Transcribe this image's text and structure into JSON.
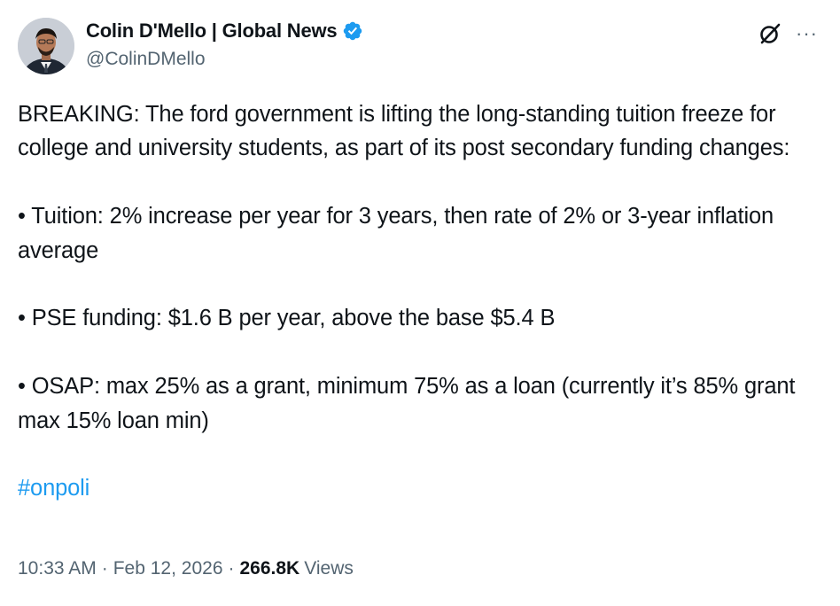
{
  "author": {
    "display_name": "Colin D'Mello | Global News",
    "handle": "@ColinDMello",
    "verified": true,
    "verified_color": "#1d9bf0"
  },
  "header_icons": {
    "grok": "grok-icon",
    "more": "···"
  },
  "tweet": {
    "paragraphs": [
      "BREAKING: The ford government is lifting the long-standing tuition freeze for college and university students, as part of its post secondary funding changes:",
      "• Tuition: 2% increase per year for 3 years, then rate of 2% or 3-year inflation average",
      "• PSE funding: $1.6 B per year, above the base $5.4 B",
      "• OSAP: max 25% as a grant, minimum 75% as a loan (currently it’s 85% grant max 15% loan min)"
    ],
    "hashtag": "#onpoli"
  },
  "meta": {
    "time": "10:33 AM",
    "separator": "·",
    "date": "Feb 12, 2026",
    "views_count": "266.8K",
    "views_label": "Views"
  },
  "colors": {
    "text": "#0f1419",
    "secondary": "#536471",
    "link": "#1d9bf0"
  }
}
